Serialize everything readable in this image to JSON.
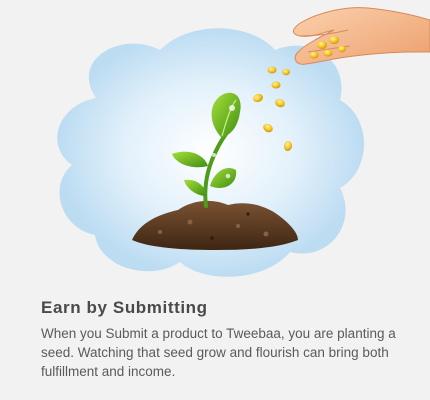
{
  "feature": {
    "title": "Earn by Submitting",
    "description": "When you Submit a product to Tweebaa, you are planting a seed.  Watching that seed grow and flourish can bring both fulfillment and income."
  },
  "illustration": {
    "icons": [
      "hand-icon",
      "seed-icon",
      "sprout-icon",
      "soil-icon",
      "cloud-backdrop"
    ],
    "colors": {
      "backdrop": "#cfe6f6",
      "leaf": "#6ab21b",
      "soil": "#5b3a22",
      "seed": "#f2c21b",
      "skin": "#f7b98c"
    }
  }
}
